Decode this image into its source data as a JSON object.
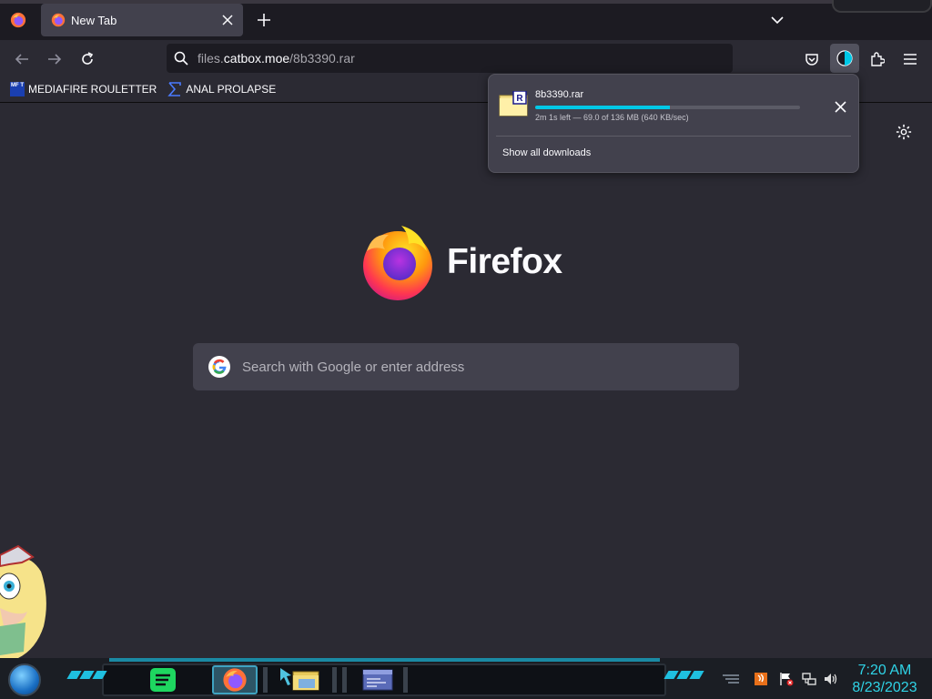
{
  "tabs": [
    {
      "title": "New Tab",
      "active": true
    }
  ],
  "urlbar": {
    "url_host": "files.catbox.moe",
    "url_host_prefix": "files.",
    "url_host_main": "catbox.moe",
    "url_path": "/8b3390.rar"
  },
  "bookmarks": [
    {
      "label": "MEDIAFIRE ROULETTER",
      "icon": "mediafire-icon",
      "icon_text": "MF T"
    },
    {
      "label": "ANAL PROLAPSE",
      "icon": "sigma-icon"
    }
  ],
  "newtab": {
    "brand": "Firefox",
    "search_placeholder": "Search with Google or enter address"
  },
  "downloads_panel": {
    "file_name": "8b3390.rar",
    "status": "2m 1s left — 69.0 of 136 MB (640 KB/sec)",
    "progress_fraction": 0.507,
    "show_all_label": "Show all downloads",
    "file_badge": "R"
  },
  "taskbar": {
    "apps": [
      "spotify-icon",
      "firefox-icon",
      "file-explorer-icon",
      "window-manager-icon"
    ],
    "clock_time": "7:20 AM",
    "clock_date": "8/23/2023"
  },
  "colors": {
    "accent": "#00c8e6",
    "toolbar": "#2b2a33",
    "tabstrip": "#1c1b22",
    "clock": "#2fd3e6"
  }
}
